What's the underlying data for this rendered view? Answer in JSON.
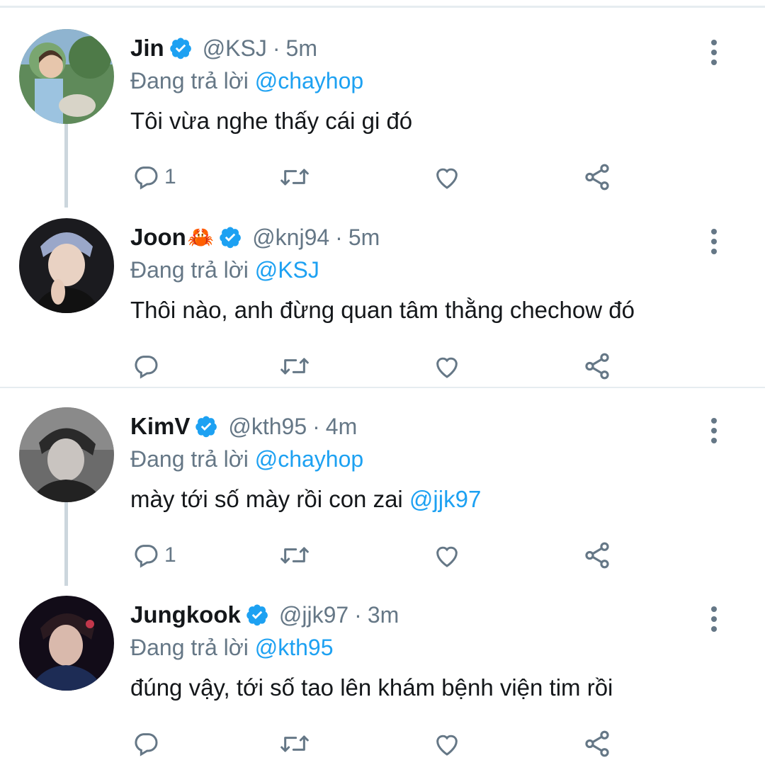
{
  "colors": {
    "text": "#14171a",
    "secondary": "#657786",
    "link": "#1da1f2",
    "verified": "#1da1f2",
    "divider": "#e6ecf0",
    "thread_line": "#ccd6dd"
  },
  "tweets": [
    {
      "name": "Jin",
      "emoji": "",
      "verified": true,
      "handle": "@KSJ",
      "separator": "·",
      "time": "5m",
      "replying_prefix": "Đang trả lời",
      "replying_to": "@chayhop",
      "text": "Tôi vừa nghe thấy cái gi đó",
      "text_mention": "",
      "reply_count": "1",
      "avatar_icon": "avatar-photo"
    },
    {
      "name": "Joon",
      "emoji": "🦀",
      "verified": true,
      "handle": "@knj94",
      "separator": "·",
      "time": "5m",
      "replying_prefix": "Đang trả lời",
      "replying_to": "@KSJ",
      "text": "Thôi nào, anh đừng quan tâm thằng chechow đó",
      "text_mention": "",
      "reply_count": "",
      "avatar_icon": "avatar-photo"
    },
    {
      "name": "KimV",
      "emoji": "",
      "verified": true,
      "handle": "@kth95",
      "separator": "·",
      "time": "4m",
      "replying_prefix": "Đang trả lời",
      "replying_to": "@chayhop",
      "text": "mày tới số mày rồi con zai ",
      "text_mention": "@jjk97",
      "reply_count": "1",
      "avatar_icon": "avatar-photo"
    },
    {
      "name": "Jungkook",
      "emoji": "",
      "verified": true,
      "handle": "@jjk97",
      "separator": "·",
      "time": "3m",
      "replying_prefix": "Đang trả lời",
      "replying_to": "@kth95",
      "text": "đúng vậy, tới số tao lên khám bệnh viện tim rồi",
      "text_mention": "",
      "reply_count": "",
      "avatar_icon": "avatar-photo"
    }
  ],
  "actions": [
    "reply-icon",
    "retweet-icon",
    "like-icon",
    "share-icon",
    "more-icon",
    "verified-badge-icon"
  ]
}
